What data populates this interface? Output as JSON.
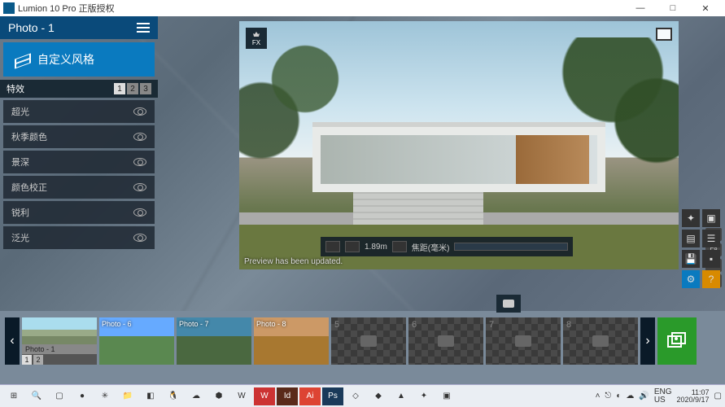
{
  "window": {
    "title": "Lumion 10 Pro 正版授权"
  },
  "left": {
    "photo_header": "Photo - 1",
    "style_button": "自定义风格",
    "effects_label": "特效",
    "pages": [
      "1",
      "2",
      "3"
    ],
    "active_page": "1",
    "effects": [
      "超光",
      "秋季颜色",
      "景深",
      "颜色校正",
      "锐利",
      "泛光"
    ]
  },
  "viewport": {
    "fx_badge": "FX",
    "status": "Preview has been updated.",
    "toolbar": {
      "distance": "1.89m",
      "focus_label": "焦距(毫米)"
    },
    "side_keys": [
      "F11",
      "F8",
      "F9",
      "U"
    ]
  },
  "thumbs": {
    "items": [
      {
        "label": "Photo - 1",
        "cls": "p1",
        "sel": true
      },
      {
        "label": "Photo - 6",
        "cls": "p6"
      },
      {
        "label": "Photo - 7",
        "cls": "p7"
      },
      {
        "label": "Photo - 8",
        "cls": "p8"
      },
      {
        "num": "5",
        "empty": true
      },
      {
        "num": "6",
        "empty": true
      },
      {
        "num": "7",
        "empty": true,
        "active": true
      },
      {
        "num": "8",
        "empty": true
      }
    ],
    "sel_caption": "Photo - 1",
    "sel_pages": [
      "1",
      "2"
    ]
  },
  "taskbar": {
    "lang1": "ENG",
    "lang2": "US",
    "time": "11:07",
    "date": "2020/9/17"
  }
}
